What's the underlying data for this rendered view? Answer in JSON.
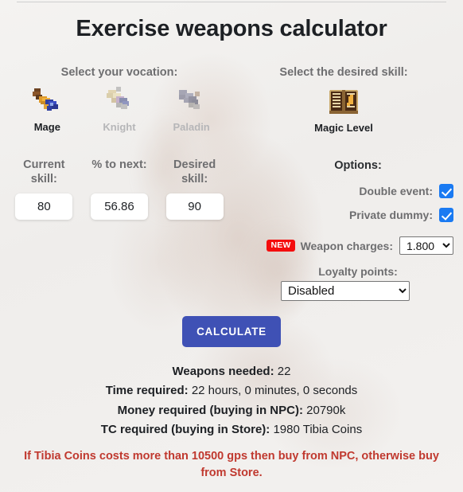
{
  "page": {
    "title": "Exercise weapons calculator"
  },
  "vocation": {
    "heading": "Select your vocation:",
    "items": [
      {
        "label": "Mage",
        "icon": "mage-sprite-icon",
        "selected": true
      },
      {
        "label": "Knight",
        "icon": "knight-sprite-icon",
        "selected": false
      },
      {
        "label": "Paladin",
        "icon": "paladin-sprite-icon",
        "selected": false
      }
    ]
  },
  "skill": {
    "heading": "Select the desired skill:",
    "label": "Magic Level",
    "icon": "spellbook-icon"
  },
  "fields": [
    {
      "label": "Current skill:",
      "value": "80",
      "name": "current-skill"
    },
    {
      "label": "% to next:",
      "value": "56.86",
      "name": "percent-to-next"
    },
    {
      "label": "Desired skill:",
      "value": "90",
      "name": "desired-skill"
    }
  ],
  "options": {
    "title": "Options:",
    "double_event": {
      "label": "Double event:",
      "checked": true
    },
    "private_dummy": {
      "label": "Private dummy:",
      "checked": true
    },
    "weapon_charges": {
      "badge": "NEW",
      "label": "Weapon charges:",
      "value": "1.800",
      "choices": [
        "1.800"
      ]
    },
    "loyalty_points": {
      "label": "Loyalty points:",
      "value": "Disabled",
      "choices": [
        "Disabled"
      ]
    }
  },
  "actions": {
    "calculate_label": "CALCULATE"
  },
  "results": [
    {
      "label": "Weapons needed:",
      "value": "22"
    },
    {
      "label": "Time required:",
      "value": "22 hours, 0 minutes, 0 seconds"
    },
    {
      "label": "Money required (buying in NPC):",
      "value": "20790k"
    },
    {
      "label": "TC required (buying in Store):",
      "value": "1980 Tibia Coins"
    }
  ],
  "warning": "If Tibia Coins costs more than 10500 gps then buy from NPC, otherwise buy from Store.",
  "colors": {
    "accent_button": "#3f51b5",
    "checkbox": "#1a7af2",
    "badge": "#f40d0d",
    "warning_text": "#c0392f"
  }
}
